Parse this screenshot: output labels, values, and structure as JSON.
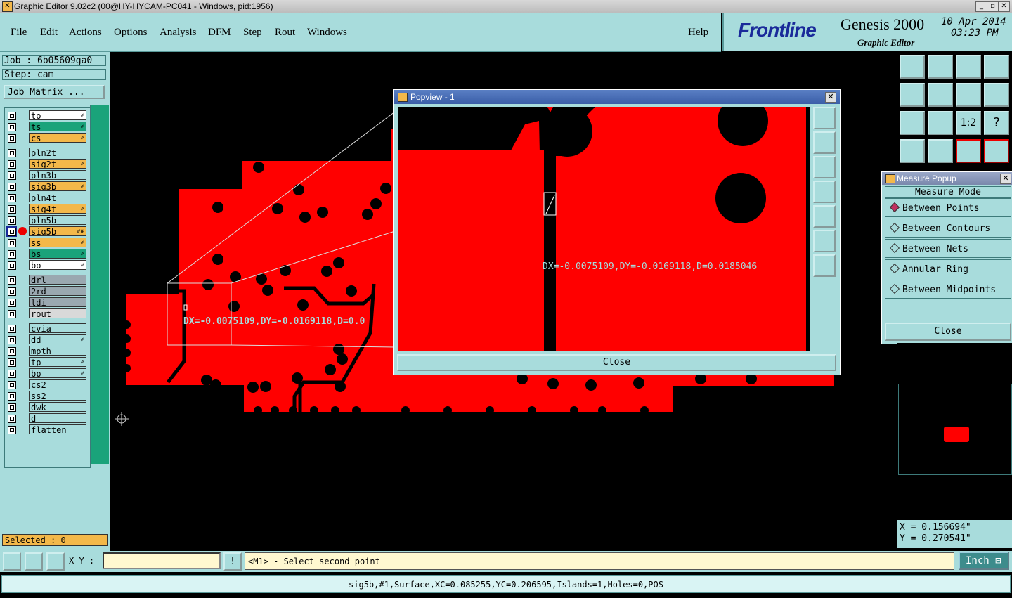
{
  "window": {
    "title": "Graphic Editor 9.02c2 (00@HY-HYCAM-PC041 - Windows, pid:1956)"
  },
  "menu": [
    "File",
    "Edit",
    "Actions",
    "Options",
    "Analysis",
    "DFM",
    "Step",
    "Rout",
    "Windows"
  ],
  "help": "Help",
  "brand": {
    "logo": "Frontline",
    "product": "Genesis 2000",
    "subtitle": "Graphic Editor",
    "date": "10 Apr 2014",
    "time": "03:23 PM"
  },
  "job": {
    "job_label": "Job : 6b05609ga0",
    "step_label": "Step: cam",
    "matrix_button": "Job Matrix ..."
  },
  "layers": [
    {
      "name": "to",
      "color": "#ffffff",
      "mark": "✐"
    },
    {
      "name": "ts",
      "color": "#1aa37a",
      "mark": "✐"
    },
    {
      "name": "cs",
      "color": "#f3b84a",
      "mark": "✐"
    },
    {
      "name": "pln2t",
      "color": "#a8dcdc",
      "mark": ""
    },
    {
      "name": "sig2t",
      "color": "#f3b84a",
      "mark": "✐"
    },
    {
      "name": "pln3b",
      "color": "#a8dcdc",
      "mark": ""
    },
    {
      "name": "sig3b",
      "color": "#f3b84a",
      "mark": "✐"
    },
    {
      "name": "pln4t",
      "color": "#a8dcdc",
      "mark": ""
    },
    {
      "name": "sig4t",
      "color": "#f3b84a",
      "mark": "✐"
    },
    {
      "name": "pln5b",
      "color": "#a8dcdc",
      "mark": ""
    },
    {
      "name": "sig5b",
      "color": "#f3b84a",
      "mark": "✐⊞"
    },
    {
      "name": "ss",
      "color": "#f3b84a",
      "mark": "✐"
    },
    {
      "name": "bs",
      "color": "#1aa37a",
      "mark": "✐"
    },
    {
      "name": "bo",
      "color": "#ffffff",
      "mark": "✐"
    },
    {
      "name": "drl",
      "color": "#9aa8b0",
      "mark": ""
    },
    {
      "name": "2rd",
      "color": "#9aa8b0",
      "mark": ""
    },
    {
      "name": "ldi",
      "color": "#9aa8b0",
      "mark": ""
    },
    {
      "name": "rout",
      "color": "#d9d9d9",
      "mark": ""
    },
    {
      "name": "cvia",
      "color": "#a8dcdc",
      "mark": ""
    },
    {
      "name": "dd",
      "color": "#a8dcdc",
      "mark": "✐"
    },
    {
      "name": "mpth",
      "color": "#a8dcdc",
      "mark": ""
    },
    {
      "name": "tp",
      "color": "#a8dcdc",
      "mark": "✐"
    },
    {
      "name": "bp",
      "color": "#a8dcdc",
      "mark": "✐"
    },
    {
      "name": "cs2",
      "color": "#a8dcdc",
      "mark": ""
    },
    {
      "name": "ss2",
      "color": "#a8dcdc",
      "mark": ""
    },
    {
      "name": "dwk",
      "color": "#a8dcdc",
      "mark": ""
    },
    {
      "name": "d",
      "color": "#a8dcdc",
      "mark": ""
    },
    {
      "name": "flatten",
      "color": "#a8dcdc",
      "mark": ""
    }
  ],
  "selected": "Selected : 0",
  "canvas": {
    "measure_text": "DX=-0.0075109,DY=-0.0169118,D=0.0"
  },
  "popview": {
    "title": "Popview - 1",
    "measure_text": "DX=-0.0075109,DY=-0.0169118,D=0.0185046",
    "close": "Close"
  },
  "measure_popup": {
    "title": "Measure Popup",
    "heading": "Measure Mode",
    "options": [
      "Between Points",
      "Between Contours",
      "Between Nets",
      "Annular Ring",
      "Between Midpoints"
    ],
    "selected_index": 0,
    "close": "Close"
  },
  "coords": {
    "x": "X = 0.156694\"",
    "y": "Y = 0.270541\""
  },
  "bottom": {
    "xy_label": "X Y :",
    "prompt": "<M1> - Select second point",
    "units": "Inch"
  },
  "status": "sig5b,#1,Surface,XC=0.085255,YC=0.206595,Islands=1,Holes=0,POS",
  "colors": {
    "panel": "#a8dcdc",
    "copper": "#ff0000",
    "title_bar": "#3a5ea8"
  }
}
